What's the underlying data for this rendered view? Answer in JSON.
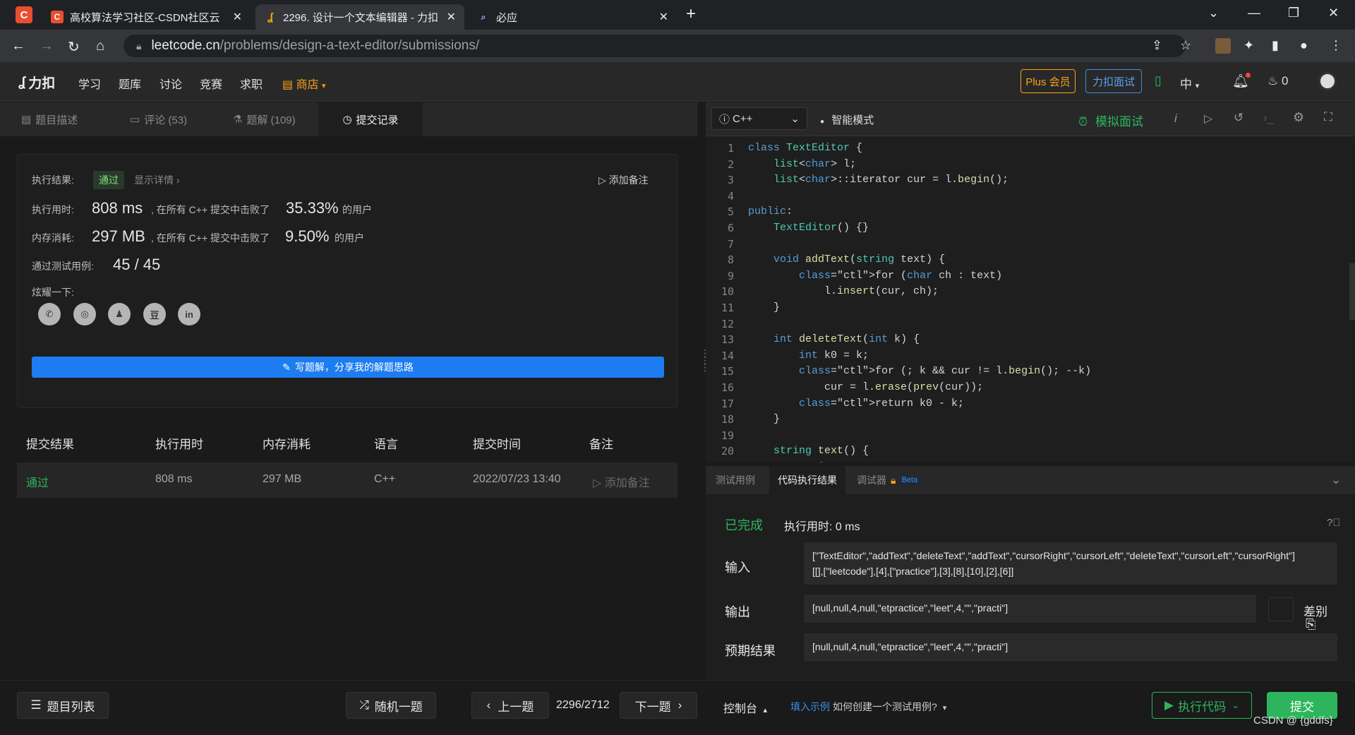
{
  "browser": {
    "tabs": [
      {
        "label": "高校算法学习社区-CSDN社区云",
        "favicon": "C",
        "favicon_color": "#e94f2f"
      },
      {
        "label": "2296. 设计一个文本编辑器 - 力扣",
        "favicon": "⥉",
        "favicon_color": "#ffa116"
      },
      {
        "label": "必应",
        "favicon": "⌕",
        "favicon_color": "#8ab4f8"
      }
    ],
    "address_host": "leetcode.cn",
    "address_path": "/problems/design-a-text-editor/submissions/"
  },
  "nav": {
    "logo": "力扣",
    "items": [
      "学习",
      "题库",
      "讨论",
      "竞赛",
      "求职"
    ],
    "shop": "商店",
    "plus": "Plus 会员",
    "interview": "力扣面试",
    "lang": "中",
    "points": "0"
  },
  "left_tabs": [
    {
      "label": "题目描述"
    },
    {
      "label": "评论 (53)"
    },
    {
      "label": "题解 (109)"
    },
    {
      "label": "提交记录"
    }
  ],
  "result": {
    "status_label": "执行结果:",
    "status": "通过",
    "details": "显示详情 ›",
    "add_note": "添加备注",
    "time_label": "执行用时:",
    "time_value": "808 ms",
    "time_mid": ", 在所有 C++ 提交中击败了",
    "time_pct": "35.33%",
    "time_suffix": "的用户",
    "mem_label": "内存消耗:",
    "mem_value": "297 MB",
    "mem_mid": ", 在所有 C++ 提交中击败了",
    "mem_pct": "9.50%",
    "mem_suffix": "的用户",
    "cases_label": "通过测试用例:",
    "cases_value": "45 / 45",
    "share_label": "炫耀一下:",
    "share_icons": [
      "wechat-icon",
      "weibo-icon",
      "qq-icon",
      "douban-icon",
      "linkedin-icon"
    ],
    "write_solution": "写题解，分享我的解题思路"
  },
  "submissions": {
    "headers": [
      "提交结果",
      "执行用时",
      "内存消耗",
      "语言",
      "提交时间",
      "备注"
    ],
    "rows": [
      {
        "result": "通过",
        "time": "808 ms",
        "memory": "297 MB",
        "lang": "C++",
        "date": "2022/07/23 13:40",
        "note": "添加备注"
      }
    ]
  },
  "editor": {
    "language": "C++",
    "mode": "智能模式",
    "mock": "模拟面试",
    "lines": [
      "class TextEditor {",
      "    list<char> l;",
      "    list<char>::iterator cur = l.begin();",
      "",
      "public:",
      "    TextEditor() {}",
      "",
      "    void addText(string text) {",
      "        for (char ch : text)",
      "            l.insert(cur, ch);",
      "    }",
      "",
      "    int deleteText(int k) {",
      "        int k0 = k;",
      "        for (; k && cur != l.begin(); --k)",
      "            cur = l.erase(prev(cur));",
      "        return k0 - k;",
      "    }",
      "",
      "    string text() {",
      "        string s;"
    ]
  },
  "console": {
    "tabs": [
      "测试用例",
      "代码执行结果",
      "调试器"
    ],
    "beta": "Beta",
    "done": "已完成",
    "time": "执行用时: 0 ms",
    "input_label": "输入",
    "input_line1": "[\"TextEditor\",\"addText\",\"deleteText\",\"addText\",\"cursorRight\",\"cursorLeft\",\"deleteText\",\"cursorLeft\",\"cursorRight\"]",
    "input_line2": "[[],[\"leetcode\"],[4],[\"practice\"],[3],[8],[10],[2],[6]]",
    "output_label": "输出",
    "output_value": "[null,null,4,null,\"etpractice\",\"leet\",4,\"\",\"practi\"]",
    "diff": "差别",
    "expected_label": "预期结果",
    "expected_value": "[null,null,4,null,\"etpractice\",\"leet\",4,\"\",\"practi\"]"
  },
  "bottom": {
    "problem_list": "题目列表",
    "random": "随机一题",
    "prev": "上一题",
    "counter": "2296/2712",
    "next": "下一题",
    "console": "控制台",
    "fill_example": "填入示例",
    "how_create": "如何创建一个测试用例?",
    "run": "执行代码",
    "submit": "提交",
    "watermark": "CSDN @ {gddfs}"
  },
  "colors": {
    "accent": "#ffa116",
    "green": "#2db55d",
    "blue": "#1c7cf0"
  }
}
